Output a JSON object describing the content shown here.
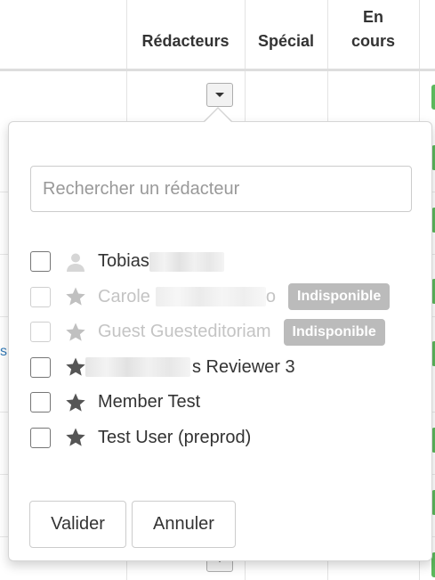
{
  "table": {
    "columns": [
      {
        "key": "redacteurs",
        "label": "Rédacteurs"
      },
      {
        "key": "special",
        "label": "Spécial"
      },
      {
        "key": "en_cours",
        "label": "En\ncours"
      }
    ],
    "link_fragment": "si"
  },
  "popover": {
    "search_placeholder": "Rechercher un rédacteur",
    "editors": [
      {
        "name": "Tobias",
        "icon": "user-icon",
        "disabled": false,
        "badge": ""
      },
      {
        "name": "Carole",
        "name_tail": "o",
        "icon": "star-icon",
        "disabled": true,
        "badge": "Indisponible"
      },
      {
        "name": "Guest Guesteditoriam",
        "icon": "star-icon",
        "disabled": true,
        "badge": "Indisponible"
      },
      {
        "name": "s Reviewer 3",
        "icon": "star-icon",
        "disabled": false,
        "badge": ""
      },
      {
        "name": "Member Test",
        "icon": "star-icon",
        "disabled": false,
        "badge": ""
      },
      {
        "name": "Test User (preprod)",
        "icon": "star-icon",
        "disabled": false,
        "badge": ""
      }
    ],
    "validate_label": "Valider",
    "cancel_label": "Annuler"
  },
  "colors": {
    "accent_green": "#5cb85c",
    "badge_gray": "#bbbbbb",
    "link_blue": "#337ab7"
  }
}
